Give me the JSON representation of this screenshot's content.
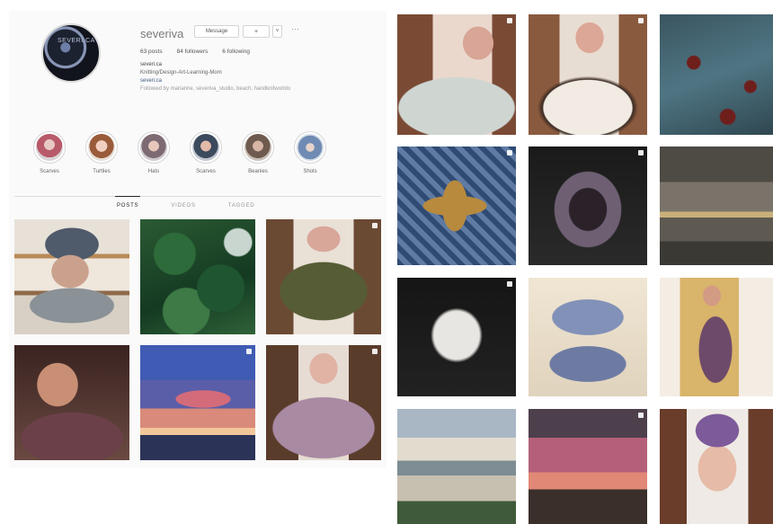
{
  "profile": {
    "username": "severiva",
    "avatar_text": "SEVERI.CA",
    "buttons": {
      "message": "Message",
      "follow": "+",
      "caret": "˅",
      "more": "···"
    },
    "stats": {
      "posts": "63 posts",
      "followers": "84 followers",
      "following": "6 following"
    },
    "bio": {
      "name": "severi.ca",
      "line1": "Knitting/Design-Art-Learning-Mom",
      "link": "severi.ca",
      "followed_by": "Followed by marianne, severiva_studio, beach, handknitworldo"
    }
  },
  "stories": [
    {
      "label": "Scarves"
    },
    {
      "label": "Turtlies"
    },
    {
      "label": "Hats"
    },
    {
      "label": "Scarves"
    },
    {
      "label": "Beanies"
    },
    {
      "label": "Shots"
    }
  ],
  "tabs": {
    "posts": "POSTS",
    "videos": "VIDEOS",
    "tagged": "TAGGED"
  },
  "colors": {
    "panel_bg": "#fafafa",
    "link": "#3d5a80",
    "border": "#dbdbdb"
  }
}
